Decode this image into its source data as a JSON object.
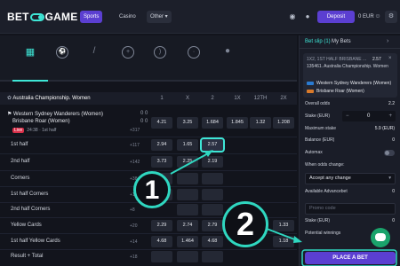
{
  "topbar": {
    "logo_left": "BET",
    "logo_right": "GAME",
    "nav": [
      {
        "label": "Sports"
      },
      {
        "label": "Casino"
      },
      {
        "label": "Other ▾"
      }
    ],
    "deposit_label": "Deposit",
    "balance": "0 EUR"
  },
  "league": {
    "name": "Australia Championship. Women"
  },
  "columns": [
    "1",
    "X",
    "2",
    "1X",
    "12TH",
    "2X"
  ],
  "match": {
    "home": "Western Sydney Wanderers (Women)",
    "away": "Brisbane Roar (Women)",
    "home_score": "0 0",
    "away_score": "0 0",
    "live_tag": "Live",
    "time": "24:38 · 1st half",
    "more": "+317",
    "odds": [
      "4.21",
      "3.25",
      "1.684",
      "1.845",
      "1.32",
      "1.208"
    ]
  },
  "rows": [
    {
      "label": "1st half",
      "count": "+117",
      "odds": [
        "2.94",
        "1.65",
        "2.57"
      ]
    },
    {
      "label": "2nd half",
      "count": "+142",
      "odds": [
        "3.73",
        "2.25",
        "2.19"
      ]
    },
    {
      "label": "Corners",
      "count": "+38",
      "odds": [
        "",
        "",
        ""
      ]
    },
    {
      "label": "1st half Corners",
      "count": "+12",
      "odds": [
        "",
        "",
        ""
      ]
    },
    {
      "label": "2nd half Corners",
      "count": "+8",
      "odds": [
        "",
        "",
        ""
      ]
    },
    {
      "label": "Yellow Cards",
      "count": "+20",
      "odds": [
        "2.29",
        "2.74",
        "2.79"
      ]
    },
    {
      "label": "1st half Yellow Cards",
      "count": "+14",
      "odds": [
        "4.68",
        "1.464",
        "4.68"
      ]
    },
    {
      "label": "Result + Total",
      "count": "+18",
      "odds": [
        "",
        "",
        ""
      ]
    }
  ],
  "betslip": {
    "tab_betslip": "Bet slip (1)",
    "tab_mybets": "My Bets",
    "market": "1X2, 1ST HALF BRISBANE ...",
    "selection_odds": "2.57",
    "league": "135461. Australia Championship. Women",
    "home": "Western Sydney Wanderers (Women)",
    "away": "Brisbane Roar (Women)",
    "overall_odds_label": "Overall odds",
    "overall_odds": "2.2",
    "stake_label": "Stake (EUR)",
    "stake": "0",
    "max_stake_label": "Maximum stake",
    "max_stake": "5.9 (EUR)",
    "balance_label": "Balance (EUR)",
    "balance": "0",
    "automax_label": "Automax",
    "odds_change_label": "When odds change:",
    "odds_change_value": "Accept any change",
    "advancebet_label": "Available Advancebet",
    "advancebet": "0",
    "promo_placeholder": "Promo code",
    "stake2_label": "Stake (EUR)",
    "stake2": "0",
    "potential_label": "Potential winnings",
    "potential": "0",
    "place_label": "PLACE A BET"
  },
  "callouts": [
    "1",
    "2"
  ]
}
